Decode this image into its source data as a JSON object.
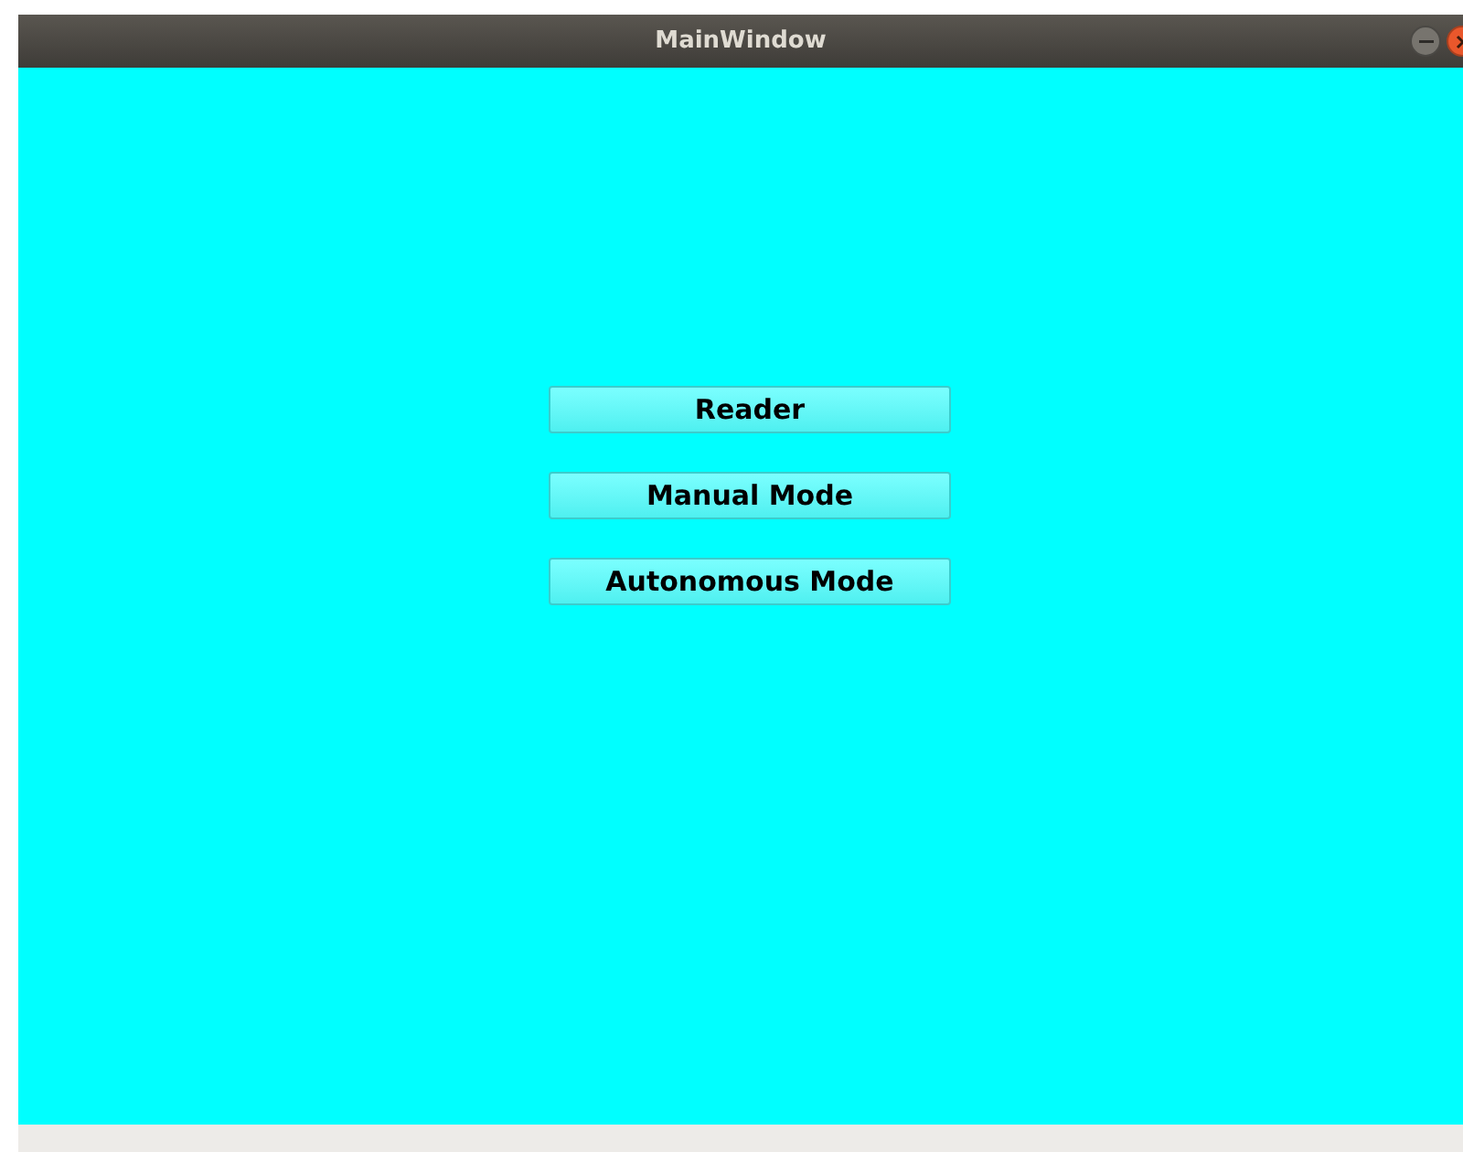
{
  "window": {
    "title": "MainWindow"
  },
  "buttons": [
    "Reader",
    "Manual Mode",
    "Autonomous Mode"
  ]
}
